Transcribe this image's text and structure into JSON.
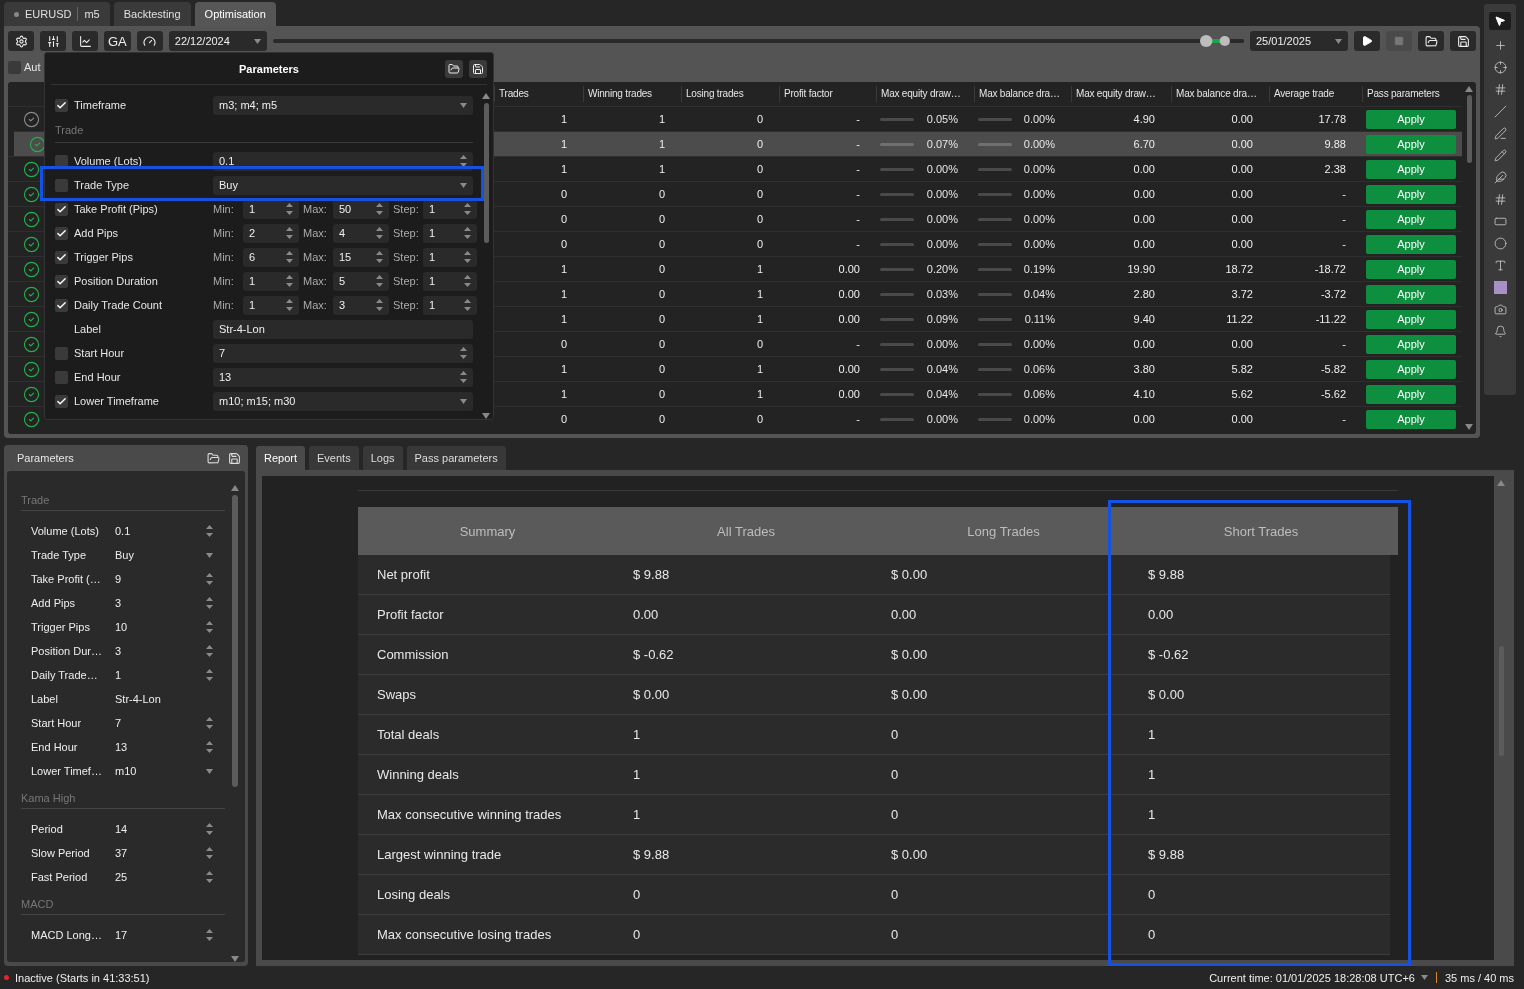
{
  "tabs": [
    {
      "kind": "symbol",
      "label": "EURUSD",
      "timeframe": "m5",
      "selected": false
    },
    {
      "kind": "plain",
      "label": "Backtesting",
      "selected": false
    },
    {
      "kind": "plain",
      "label": "Optimisation",
      "selected": true
    }
  ],
  "toolbar": {
    "ga_label": "GA",
    "start_date": "22/12/2024",
    "end_date": "25/01/2025",
    "stop_disabled": true,
    "range_slider": {
      "level": 0.98
    }
  },
  "auto_option": {
    "label": "Aut",
    "checked": false
  },
  "results": {
    "columns": [
      {
        "label": "Trades",
        "kind": "number"
      },
      {
        "label": "Winning trades",
        "kind": "number"
      },
      {
        "label": "Losing trades",
        "kind": "number"
      },
      {
        "label": "Profit factor",
        "kind": "number"
      },
      {
        "label": "Max equity draw…",
        "kind": "gauge"
      },
      {
        "label": "Max balance dra…",
        "kind": "gauge"
      },
      {
        "label": "Max equity draw…",
        "kind": "number"
      },
      {
        "label": "Max balance dra…",
        "kind": "number"
      },
      {
        "label": "Average trade",
        "kind": "number"
      },
      {
        "label": "Pass parameters",
        "kind": "action"
      }
    ],
    "rows": [
      {
        "passed": false,
        "selected": false,
        "cells": [
          "1",
          "1",
          "0",
          "-",
          "0.05%",
          "0.00%",
          "4.90",
          "0.00",
          "17.78",
          "Apply"
        ]
      },
      {
        "passed": true,
        "selected": true,
        "cells": [
          "1",
          "1",
          "0",
          "-",
          "0.07%",
          "0.00%",
          "6.70",
          "0.00",
          "9.88",
          "Apply"
        ]
      },
      {
        "passed": true,
        "selected": false,
        "cells": [
          "1",
          "1",
          "0",
          "-",
          "0.00%",
          "0.00%",
          "0.00",
          "0.00",
          "2.38",
          "Apply"
        ]
      },
      {
        "passed": true,
        "selected": false,
        "cells": [
          "0",
          "0",
          "0",
          "-",
          "0.00%",
          "0.00%",
          "0.00",
          "0.00",
          "-",
          "Apply"
        ]
      },
      {
        "passed": true,
        "selected": false,
        "cells": [
          "0",
          "0",
          "0",
          "-",
          "0.00%",
          "0.00%",
          "0.00",
          "0.00",
          "-",
          "Apply"
        ]
      },
      {
        "passed": true,
        "selected": false,
        "cells": [
          "0",
          "0",
          "0",
          "-",
          "0.00%",
          "0.00%",
          "0.00",
          "0.00",
          "-",
          "Apply"
        ]
      },
      {
        "passed": true,
        "selected": false,
        "cells": [
          "1",
          "0",
          "1",
          "0.00",
          "0.20%",
          "0.19%",
          "19.90",
          "18.72",
          "-18.72",
          "Apply"
        ]
      },
      {
        "passed": true,
        "selected": false,
        "cells": [
          "1",
          "0",
          "1",
          "0.00",
          "0.03%",
          "0.04%",
          "2.80",
          "3.72",
          "-3.72",
          "Apply"
        ]
      },
      {
        "passed": true,
        "selected": false,
        "cells": [
          "1",
          "0",
          "1",
          "0.00",
          "0.09%",
          "0.11%",
          "9.40",
          "11.22",
          "-11.22",
          "Apply"
        ]
      },
      {
        "passed": true,
        "selected": false,
        "cells": [
          "0",
          "0",
          "0",
          "-",
          "0.00%",
          "0.00%",
          "0.00",
          "0.00",
          "-",
          "Apply"
        ]
      },
      {
        "passed": true,
        "selected": false,
        "cells": [
          "1",
          "0",
          "1",
          "0.00",
          "0.04%",
          "0.06%",
          "3.80",
          "5.82",
          "-5.82",
          "Apply"
        ]
      },
      {
        "passed": true,
        "selected": false,
        "cells": [
          "1",
          "0",
          "1",
          "0.00",
          "0.04%",
          "0.06%",
          "4.10",
          "5.62",
          "-5.62",
          "Apply"
        ]
      },
      {
        "passed": true,
        "selected": false,
        "cells": [
          "0",
          "0",
          "0",
          "-",
          "0.00%",
          "0.00%",
          "0.00",
          "0.00",
          "-",
          "Apply"
        ]
      }
    ]
  },
  "parameters_popup": {
    "title": "Parameters",
    "items": [
      {
        "kind": "select",
        "label": "Timeframe",
        "checked": true,
        "value": "m3; m4; m5"
      },
      {
        "kind": "section",
        "label": "Trade"
      },
      {
        "kind": "spin",
        "label": "Volume (Lots)",
        "checked": false,
        "value": "0.1"
      },
      {
        "kind": "select",
        "label": "Trade Type",
        "checked": false,
        "value": "Buy"
      },
      {
        "kind": "range",
        "label": "Take Profit (Pips)",
        "checked": true,
        "parts": [
          {
            "label": "Min:",
            "value": "1"
          },
          {
            "label": "Max:",
            "value": "50"
          },
          {
            "label": "Step:",
            "value": "1"
          }
        ]
      },
      {
        "kind": "range",
        "label": "Add Pips",
        "checked": true,
        "parts": [
          {
            "label": "Min:",
            "value": "2"
          },
          {
            "label": "Max:",
            "value": "4"
          },
          {
            "label": "Step:",
            "value": "1"
          }
        ]
      },
      {
        "kind": "range",
        "label": "Trigger Pips",
        "checked": true,
        "parts": [
          {
            "label": "Min:",
            "value": "6"
          },
          {
            "label": "Max:",
            "value": "15"
          },
          {
            "label": "Step:",
            "value": "1"
          }
        ]
      },
      {
        "kind": "range",
        "label": "Position Duration",
        "checked": true,
        "parts": [
          {
            "label": "Min:",
            "value": "1"
          },
          {
            "label": "Max:",
            "value": "5"
          },
          {
            "label": "Step:",
            "value": "1"
          }
        ]
      },
      {
        "kind": "range",
        "label": "Daily Trade Count",
        "checked": true,
        "parts": [
          {
            "label": "Min:",
            "value": "1"
          },
          {
            "label": "Max:",
            "value": "3"
          },
          {
            "label": "Step:",
            "value": "1"
          }
        ]
      },
      {
        "kind": "text",
        "label": "Label",
        "value": "Str-4-Lon"
      },
      {
        "kind": "spin",
        "label": "Start Hour",
        "checked": false,
        "value": "7"
      },
      {
        "kind": "spin",
        "label": "End Hour",
        "checked": false,
        "value": "13"
      },
      {
        "kind": "select",
        "label": "Lower Timeframe",
        "checked": true,
        "value": "m10; m15; m30"
      }
    ]
  },
  "parameters_panel": {
    "title": "Parameters",
    "items": [
      {
        "kind": "section",
        "label": "Trade"
      },
      {
        "kind": "spin",
        "label": "Volume (Lots)",
        "value": "0.1"
      },
      {
        "kind": "select",
        "label": "Trade Type",
        "value": "Buy"
      },
      {
        "kind": "spin",
        "label": "Take Profit (…",
        "value": "9"
      },
      {
        "kind": "spin",
        "label": "Add Pips",
        "value": "3"
      },
      {
        "kind": "spin",
        "label": "Trigger Pips",
        "value": "10"
      },
      {
        "kind": "spin",
        "label": "Position Dur…",
        "value": "3"
      },
      {
        "kind": "spin",
        "label": "Daily Trade…",
        "value": "1"
      },
      {
        "kind": "text",
        "label": "Label",
        "value": "Str-4-Lon"
      },
      {
        "kind": "spin",
        "label": "Start Hour",
        "value": "7"
      },
      {
        "kind": "spin",
        "label": "End Hour",
        "value": "13"
      },
      {
        "kind": "select",
        "label": "Lower Timef…",
        "value": "m10"
      },
      {
        "kind": "section",
        "label": "Kama High"
      },
      {
        "kind": "spin",
        "label": "Period",
        "value": "14"
      },
      {
        "kind": "spin",
        "label": "Slow Period",
        "value": "37"
      },
      {
        "kind": "spin",
        "label": "Fast Period",
        "value": "25"
      },
      {
        "kind": "section",
        "label": "MACD"
      },
      {
        "kind": "spin",
        "label": "MACD Long…",
        "value": "17"
      }
    ]
  },
  "report": {
    "tabs": [
      {
        "label": "Report",
        "selected": true
      },
      {
        "label": "Events",
        "selected": false
      },
      {
        "label": "Logs",
        "selected": false
      },
      {
        "label": "Pass parameters",
        "selected": false
      }
    ],
    "columns": [
      "Summary",
      "All Trades",
      "Long Trades",
      "Short Trades"
    ],
    "rows": [
      {
        "label": "Net profit",
        "values": [
          "$ 9.88",
          "$ 0.00",
          "$ 9.88"
        ]
      },
      {
        "label": "Profit factor",
        "values": [
          "0.00",
          "0.00",
          "0.00"
        ]
      },
      {
        "label": "Commission",
        "values": [
          "$ -0.62",
          "$ 0.00",
          "$ -0.62"
        ]
      },
      {
        "label": "Swaps",
        "values": [
          "$ 0.00",
          "$ 0.00",
          "$ 0.00"
        ]
      },
      {
        "label": "Total deals",
        "values": [
          "1",
          "0",
          "1"
        ]
      },
      {
        "label": "Winning deals",
        "values": [
          "1",
          "0",
          "1"
        ]
      },
      {
        "label": "Max consecutive winning trades",
        "values": [
          "1",
          "0",
          "1"
        ]
      },
      {
        "label": "Largest winning trade",
        "values": [
          "$ 9.88",
          "$ 0.00",
          "$ 9.88"
        ]
      },
      {
        "label": "Losing deals",
        "values": [
          "0",
          "0",
          "0"
        ]
      },
      {
        "label": "Max consecutive losing trades",
        "values": [
          "0",
          "0",
          "0"
        ]
      }
    ]
  },
  "status_bar": {
    "state": "Inactive (Starts in 41:33:51)",
    "time": "Current time: 01/01/2025 18:28:08 UTC+6",
    "timing": "35 ms / 40 ms"
  }
}
